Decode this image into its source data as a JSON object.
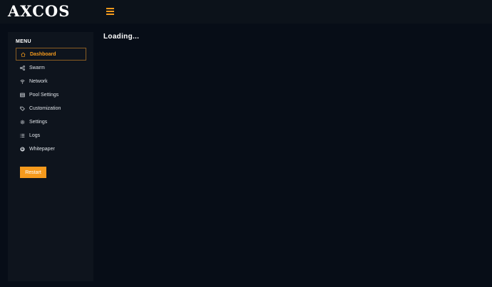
{
  "app": {
    "logo_text": "AXCOS"
  },
  "header": {
    "menu_icon": "hamburger-icon"
  },
  "sidebar": {
    "title": "MENU",
    "items": [
      {
        "label": "Dashboard",
        "icon": "home-icon",
        "active": true
      },
      {
        "label": "Swarm",
        "icon": "share-icon"
      },
      {
        "label": "Network",
        "icon": "wifi-icon"
      },
      {
        "label": "Pool Settings",
        "icon": "server-icon"
      },
      {
        "label": "Customization",
        "icon": "tag-icon"
      },
      {
        "label": "Settings",
        "icon": "gear-icon"
      },
      {
        "label": "Logs",
        "icon": "list-icon"
      },
      {
        "label": "Whitepaper",
        "icon": "bitcoin-icon"
      }
    ],
    "restart_label": "Restart"
  },
  "main": {
    "status_text": "Loading..."
  },
  "colors": {
    "accent": "#f59a1d",
    "background": "#070d17",
    "panel": "#0e141d",
    "topbar": "#0c121a"
  }
}
